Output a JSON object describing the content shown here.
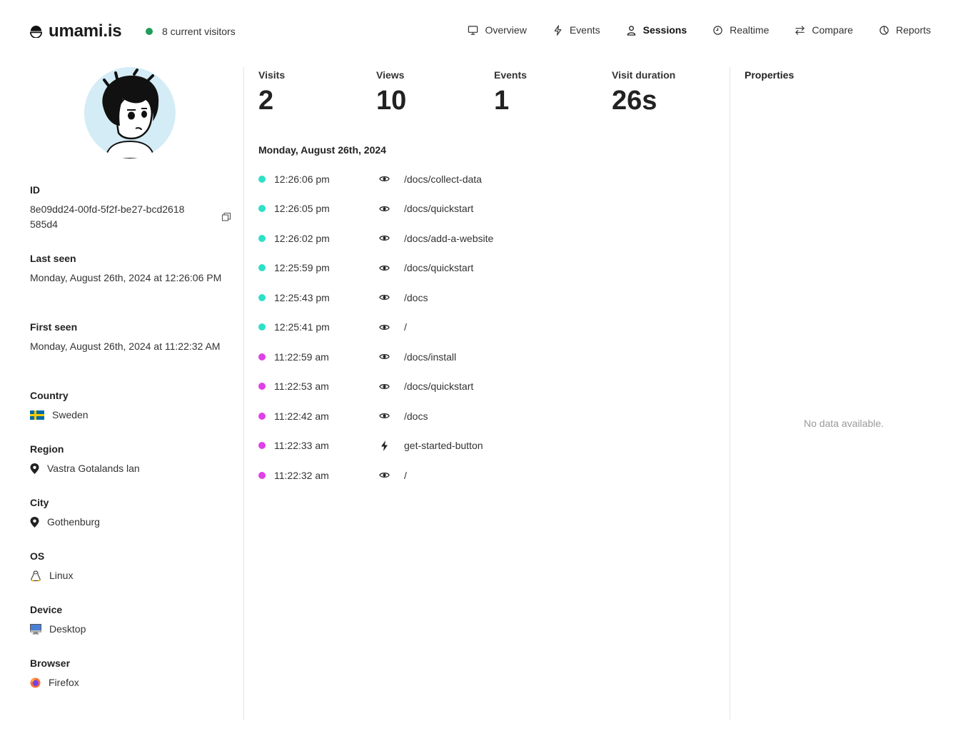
{
  "header": {
    "brand": "umami.is",
    "visitors": "8 current visitors",
    "nav": [
      {
        "label": "Overview",
        "icon": "monitor-icon"
      },
      {
        "label": "Events",
        "icon": "bolt-icon"
      },
      {
        "label": "Sessions",
        "icon": "user-icon",
        "active": true
      },
      {
        "label": "Realtime",
        "icon": "clock-icon"
      },
      {
        "label": "Compare",
        "icon": "arrows-swap-icon"
      },
      {
        "label": "Reports",
        "icon": "pie-chart-icon"
      }
    ]
  },
  "session": {
    "id_label": "ID",
    "id": "8e09dd24-00fd-5f2f-be27-bcd2618585d4",
    "last_seen_label": "Last seen",
    "last_seen": "Monday, August 26th, 2024 at 12:26:06 PM",
    "first_seen_label": "First seen",
    "first_seen": "Monday, August 26th, 2024 at 11:22:32 AM",
    "country_label": "Country",
    "country": "Sweden",
    "region_label": "Region",
    "region": "Vastra Gotalands lan",
    "city_label": "City",
    "city": "Gothenburg",
    "os_label": "OS",
    "os": "Linux",
    "device_label": "Device",
    "device": "Desktop",
    "browser_label": "Browser",
    "browser": "Firefox"
  },
  "stats": [
    {
      "label": "Visits",
      "value": "2"
    },
    {
      "label": "Views",
      "value": "10"
    },
    {
      "label": "Events",
      "value": "1"
    },
    {
      "label": "Visit duration",
      "value": "26s"
    }
  ],
  "activity": {
    "date": "Monday, August 26th, 2024",
    "items": [
      {
        "time": "12:26:06 pm",
        "type": "view",
        "path": "/docs/collect-data",
        "visit": 2
      },
      {
        "time": "12:26:05 pm",
        "type": "view",
        "path": "/docs/quickstart",
        "visit": 2
      },
      {
        "time": "12:26:02 pm",
        "type": "view",
        "path": "/docs/add-a-website",
        "visit": 2
      },
      {
        "time": "12:25:59 pm",
        "type": "view",
        "path": "/docs/quickstart",
        "visit": 2
      },
      {
        "time": "12:25:43 pm",
        "type": "view",
        "path": "/docs",
        "visit": 2
      },
      {
        "time": "12:25:41 pm",
        "type": "view",
        "path": "/",
        "visit": 2
      },
      {
        "time": "11:22:59 am",
        "type": "view",
        "path": "/docs/install",
        "visit": 1
      },
      {
        "time": "11:22:53 am",
        "type": "view",
        "path": "/docs/quickstart",
        "visit": 1
      },
      {
        "time": "11:22:42 am",
        "type": "view",
        "path": "/docs",
        "visit": 1
      },
      {
        "time": "11:22:33 am",
        "type": "event",
        "path": "get-started-button",
        "visit": 1
      },
      {
        "time": "11:22:32 am",
        "type": "view",
        "path": "/",
        "visit": 1
      }
    ]
  },
  "properties": {
    "title": "Properties",
    "empty": "No data available."
  },
  "colors": {
    "visit_1": "#e040e8",
    "visit_2": "#2ee0c8",
    "online_dot": "#1f9d5a",
    "avatar_bg": "#d4ecf5"
  }
}
